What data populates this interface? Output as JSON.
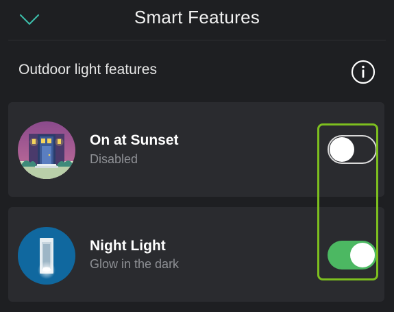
{
  "header": {
    "title": "Smart Features",
    "back_icon": "chevron-down-icon"
  },
  "section": {
    "title": "Outdoor light features",
    "info_icon": "info-icon"
  },
  "features": [
    {
      "title": "On at Sunset",
      "subtitle": "Disabled",
      "enabled": false,
      "thumbnail_icon": "house-at-sunset-icon"
    },
    {
      "title": "Night Light",
      "subtitle": "Glow in the dark",
      "enabled": true,
      "thumbnail_icon": "glowing-lamp-icon"
    }
  ],
  "colors": {
    "background": "#1e1f22",
    "card": "#2a2b2f",
    "toggle_on": "#4cb862",
    "highlight": "#7dbf1f",
    "subtitle": "#8e9095"
  }
}
